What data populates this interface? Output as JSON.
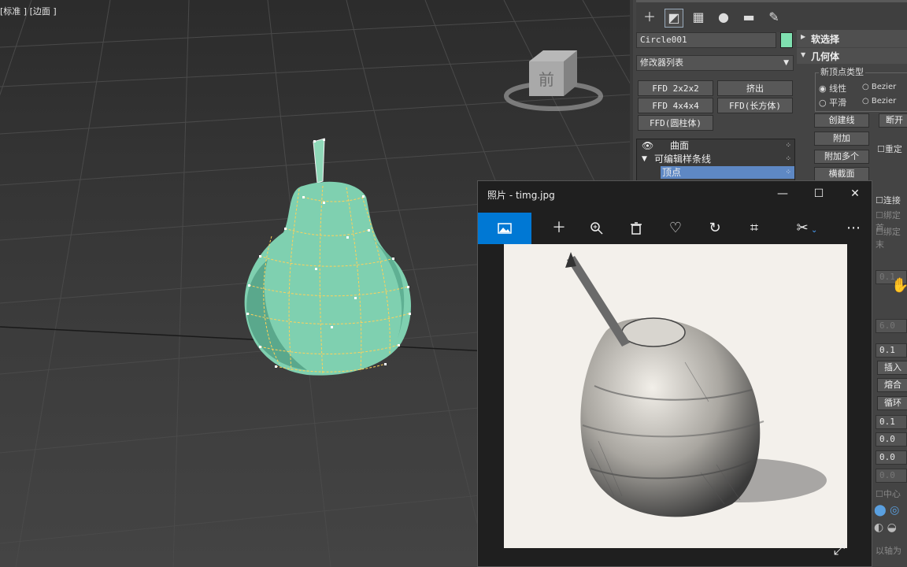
{
  "viewport": {
    "label": "[标准 ] [边面 ]",
    "viewcube_label": "前"
  },
  "command_panel": {
    "tabs": [
      "create-icon",
      "modify-icon",
      "hierarchy-icon",
      "motion-icon",
      "display-icon",
      "utilities-icon"
    ],
    "object_name": "Circle001",
    "object_color": "#7fe0b0",
    "modifier_list": "修改器列表",
    "buttons": {
      "ffd2": "FFD 2x2x2",
      "extrude": "挤出",
      "ffd4": "FFD 4x4x4",
      "ffdbox": "FFD(长方体)",
      "ffdcyl": "FFD(圆柱体)"
    },
    "stack": {
      "item1": "曲面",
      "item2": "可编辑样条线",
      "item3": "顶点"
    },
    "rollouts": {
      "soft_select": "软选择",
      "geometry": "几何体",
      "new_vertex_type": "新顶点类型",
      "linear": "线性",
      "bezier": "Bezier",
      "smooth": "平滑",
      "bezier_corner": "Bezier",
      "create_line": "创建线",
      "break": "断开",
      "attach": "附加",
      "attach_multi": "附加多个",
      "reorient": "重定",
      "cross_section": "横截面",
      "connect": "连接",
      "bind_first": "绑定首",
      "bind_last": "绑定末",
      "val1": "0.1",
      "val6": "6.0",
      "val2": "0.1",
      "insert": "插入",
      "fuse": "熔合",
      "cycle": "循环",
      "val3": "0.1",
      "val4": "0.0",
      "val5": "0.0",
      "val7": "0.0",
      "center": "中心",
      "by_axis": "以轴为"
    }
  },
  "photos_app": {
    "title": "照片 - timg.jpg",
    "controls": {
      "minimize": "—",
      "maximize": "☐",
      "close": "✕"
    },
    "toolbar": [
      "image-icon",
      "add-icon",
      "zoom-in-icon",
      "delete-icon",
      "favorite-icon",
      "rotate-icon",
      "crop-icon",
      "edit-icon",
      "more-icon"
    ],
    "accent": "#0078d4"
  }
}
